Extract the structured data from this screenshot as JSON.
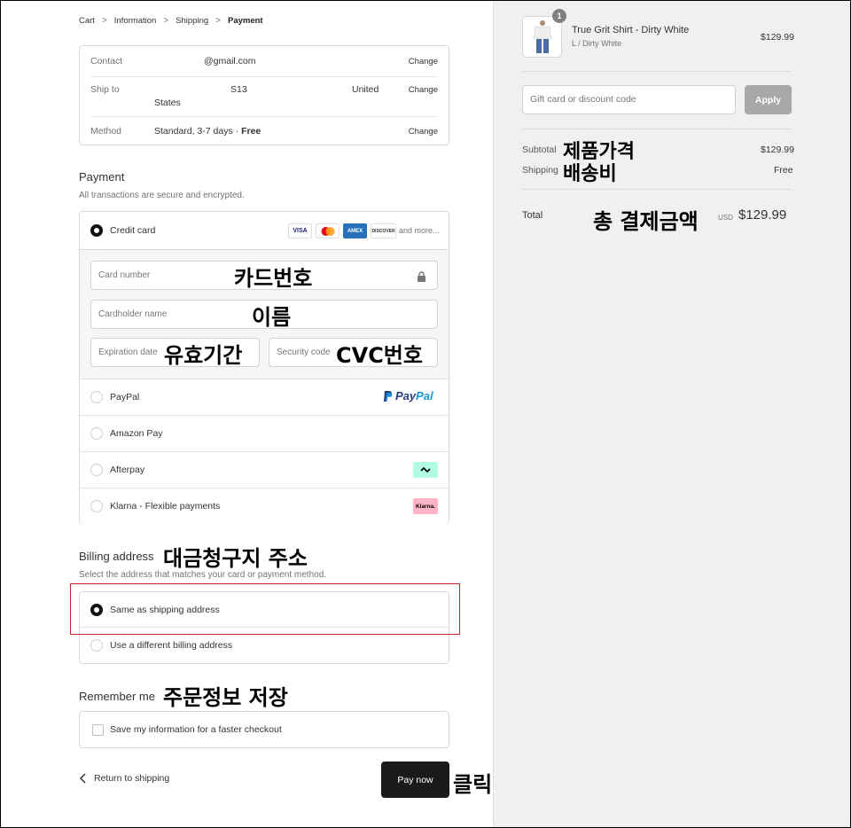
{
  "breadcrumb": {
    "cart": "Cart",
    "information": "Information",
    "shipping": "Shipping",
    "payment": "Payment"
  },
  "review": {
    "contact_label": "Contact",
    "contact_value": "@gmail.com",
    "shipto_label": "Ship to",
    "shipto_part1": "S13",
    "shipto_part2": "United",
    "shipto_part3": "States",
    "method_label": "Method",
    "method_value": "Standard, 3-7 days · ",
    "method_free": "Free",
    "change": "Change"
  },
  "payment": {
    "title": "Payment",
    "subtitle": "All transactions are secure and encrypted.",
    "credit_card": "Credit card",
    "and_more": "and more...",
    "card_logos": [
      "VISA",
      "AMEX",
      "DISCOVER"
    ],
    "card_number_placeholder": "Card number",
    "cardholder_placeholder": "Cardholder name",
    "expiration_placeholder": "Expiration date",
    "security_placeholder": "Security code",
    "paypal": "PayPal",
    "paypal_logo_a": "Pay",
    "paypal_logo_b": "Pal",
    "amazon": "Amazon Pay",
    "afterpay": "Afterpay",
    "klarna": "Klarna - Flexible payments",
    "klarna_logo": "Klarna."
  },
  "billing": {
    "title": "Billing address",
    "subtitle": "Select the address that matches your card or payment method.",
    "same": "Same as shipping address",
    "different": "Use a different billing address"
  },
  "remember": {
    "title": "Remember me",
    "save_info": "Save my information for a faster checkout"
  },
  "actions": {
    "return": "Return to shipping",
    "pay_now": "Pay now"
  },
  "annotations": {
    "card_number": "카드번호",
    "name": "이름",
    "expiry": "유효기간",
    "cvc": "CVC번호",
    "billing": "대금청구지 주소",
    "remember": "주문정보 저장",
    "click": "클릭",
    "product_price": "제품가격",
    "shipping_fee": "배송비",
    "total": "총 결제금액"
  },
  "summary": {
    "product_name": "True Grit Shirt - Dirty White",
    "product_variant": "L / Dirty White",
    "product_price": "$129.99",
    "quantity": "1",
    "gift_placeholder": "Gift card or discount code",
    "apply": "Apply",
    "subtotal_label": "Subtotal",
    "subtotal_value": "$129.99",
    "shipping_label": "Shipping",
    "shipping_value": "Free",
    "total_label": "Total",
    "currency": "USD",
    "total_value": "$129.99"
  }
}
